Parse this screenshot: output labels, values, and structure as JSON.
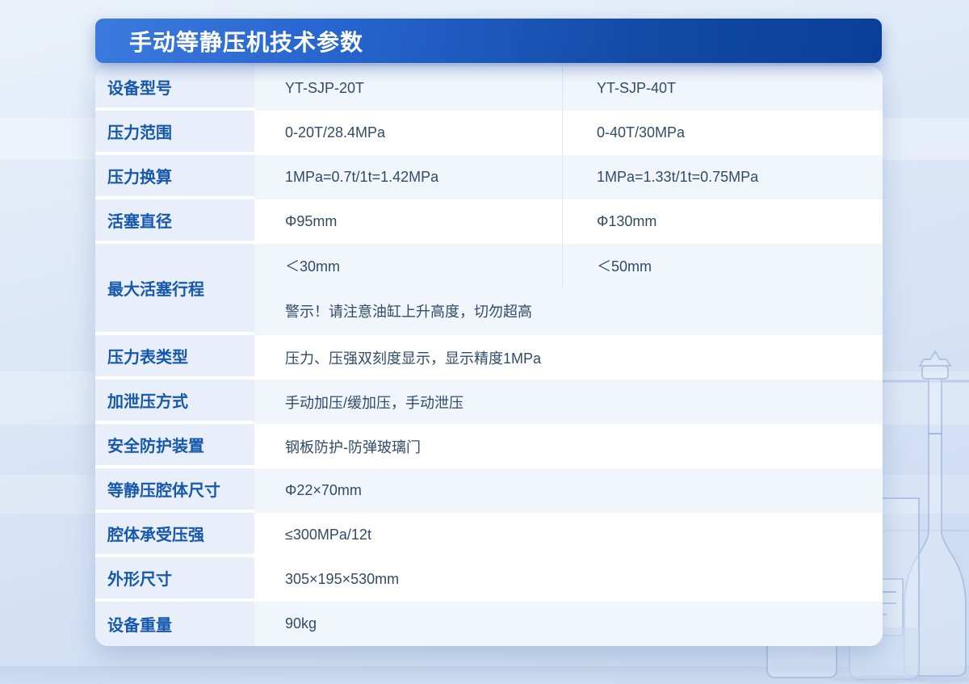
{
  "page": {
    "title": "手动等静压机技术参数"
  },
  "table": {
    "rows": [
      {
        "label": "设备型号",
        "values": [
          "YT-SJP-20T",
          "YT-SJP-40T"
        ],
        "tint": true
      },
      {
        "label": "压力范围",
        "values": [
          "0-20T/28.4MPa",
          "0-40T/30MPa"
        ],
        "tint": false
      },
      {
        "label": "压力换算",
        "values": [
          "1MPa=0.7t/1t=1.42MPa",
          "1MPa=1.33t/1t=0.75MPa"
        ],
        "tint": true
      },
      {
        "label": "活塞直径",
        "values": [
          "Φ95mm",
          "Φ130mm"
        ],
        "tint": false
      },
      {
        "label": "最大活塞行程",
        "values": [
          "＜30mm",
          "＜50mm"
        ],
        "warning": "警示！请注意油缸上升高度，切勿超高",
        "tint": true
      },
      {
        "label": "压力表类型",
        "values": [
          "压力、压强双刻度显示，显示精度1MPa"
        ],
        "tint": false
      },
      {
        "label": "加泄压方式",
        "values": [
          "手动加压/缓加压，手动泄压"
        ],
        "tint": true
      },
      {
        "label": "安全防护装置",
        "values": [
          "钢板防护-防弹玻璃门"
        ],
        "tint": false
      },
      {
        "label": "等静压腔体尺寸",
        "values": [
          "Φ22×70mm"
        ],
        "tint": true
      },
      {
        "label": "腔体承受压强",
        "values": [
          "≤300MPa/12t"
        ],
        "tint": false
      },
      {
        "label": "外形尺寸",
        "values": [
          "305×195×530mm"
        ],
        "tint": false
      },
      {
        "label": "设备重量",
        "values": [
          "90kg"
        ],
        "tint": true
      }
    ]
  },
  "colors": {
    "title_bar_gradient_start": "#3d7ade",
    "title_bar_gradient_end": "#0a3e99",
    "title_text": "#ffffff",
    "label_text": "#1659ac",
    "value_text": "#304b68",
    "label_cell_bg": "#e9effa",
    "tint_row_bg": "#f1f6fc",
    "card_bg": "#ffffff",
    "page_bg": "#d3e0f4",
    "divider": "#dee5f0"
  }
}
